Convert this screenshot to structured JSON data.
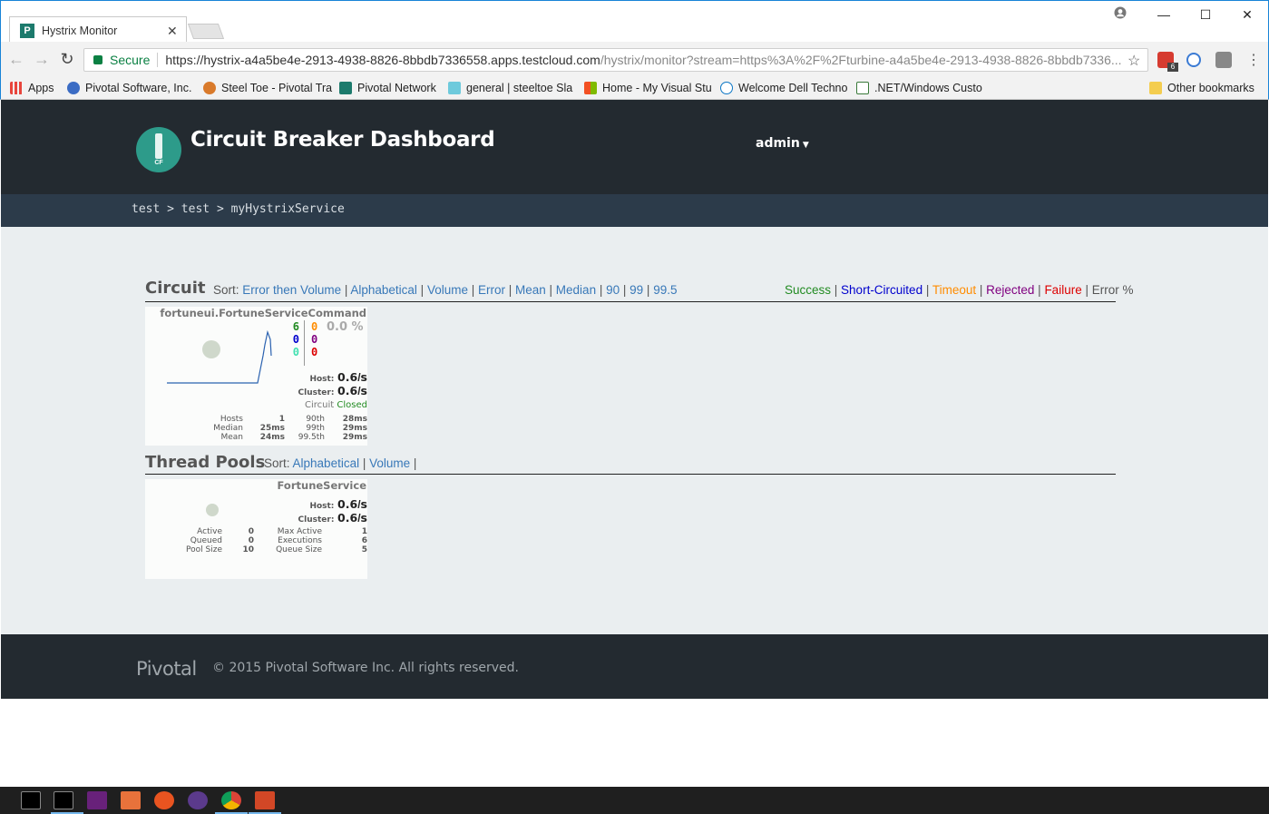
{
  "browser": {
    "tab_title": "Hystrix Monitor",
    "secure_label": "Secure",
    "url_host": "https://hystrix-a4a5be4e-2913-4938-8826-8bbdb7336558.apps.testcloud.com",
    "url_rest": "/hystrix/monitor?stream=https%3A%2F%2Fturbine-a4a5be4e-2913-4938-8826-8bbdb7336...",
    "extension_badge": "6",
    "bookmarks": [
      {
        "label": "Apps",
        "color": "#e8453c"
      },
      {
        "label": "Pivotal Software, Inc.",
        "color": "#3b6cc4"
      },
      {
        "label": "Steel Toe - Pivotal Tra",
        "color": "#d97a2b"
      },
      {
        "label": "Pivotal Network",
        "color": "#1c7a6c"
      },
      {
        "label": "general | steeltoe Sla",
        "color": "#6ecadc"
      },
      {
        "label": "Home - My Visual Stu",
        "color": "#f25022"
      },
      {
        "label": "Welcome Dell Techno",
        "color": "#0b76c5"
      },
      {
        "label": ".NET/Windows Custo",
        "color": "#3a7a3a"
      }
    ],
    "other_bookmarks": "Other bookmarks"
  },
  "header": {
    "title": "Circuit Breaker Dashboard",
    "logo_text": "CF",
    "user": "admin"
  },
  "breadcrumb": [
    "test",
    "test",
    "myHystrixService"
  ],
  "circuit": {
    "title": "Circuit",
    "sort_label": "Sort:",
    "sort_options": [
      "Error then Volume",
      "Alphabetical",
      "Volume",
      "Error",
      "Mean",
      "Median",
      "90",
      "99",
      "99.5"
    ],
    "legend": [
      {
        "label": "Success",
        "color": "#228b22"
      },
      {
        "label": "Short-Circuited",
        "color": "#0000cd"
      },
      {
        "label": "Timeout",
        "color": "#ff8c00"
      },
      {
        "label": "Rejected",
        "color": "#800080"
      },
      {
        "label": "Failure",
        "color": "#dd0000"
      },
      {
        "label": "Error %",
        "color": "#555555"
      }
    ],
    "command": {
      "name": "fortuneui.FortuneServiceCommand",
      "success": "6",
      "short_circuited": "0",
      "bad_request": "0",
      "timeout": "0",
      "rejected": "0",
      "failure": "0",
      "error_pct": "0.0 %",
      "host_label": "Host:",
      "host_rate": "0.6",
      "cluster_label": "Cluster:",
      "cluster_rate": "0.6",
      "rate_unit": "s",
      "status_prefix": "Circuit",
      "status": "Closed",
      "stats": {
        "hosts_label": "Hosts",
        "hosts": "1",
        "median_label": "Median",
        "median": "25ms",
        "mean_label": "Mean",
        "mean": "24ms",
        "p90_label": "90th",
        "p90": "28ms",
        "p99_label": "99th",
        "p99": "29ms",
        "p995_label": "99.5th",
        "p995": "29ms"
      }
    }
  },
  "thread_pools": {
    "title": "Thread Pools",
    "sort_label": "Sort:",
    "sort_options": [
      "Alphabetical",
      "Volume"
    ],
    "pool": {
      "name": "FortuneService",
      "host_label": "Host:",
      "host_rate": "0.6",
      "cluster_label": "Cluster:",
      "cluster_rate": "0.6",
      "rate_unit": "s",
      "active_label": "Active",
      "active": "0",
      "queued_label": "Queued",
      "queued": "0",
      "pool_size_label": "Pool Size",
      "pool_size": "10",
      "max_active_label": "Max Active",
      "max_active": "1",
      "executions_label": "Executions",
      "executions": "6",
      "queue_size_label": "Queue Size",
      "queue_size": "5"
    }
  },
  "footer": {
    "logo": "Pivotal",
    "copyright": "© 2015 Pivotal Software Inc. All rights reserved."
  }
}
